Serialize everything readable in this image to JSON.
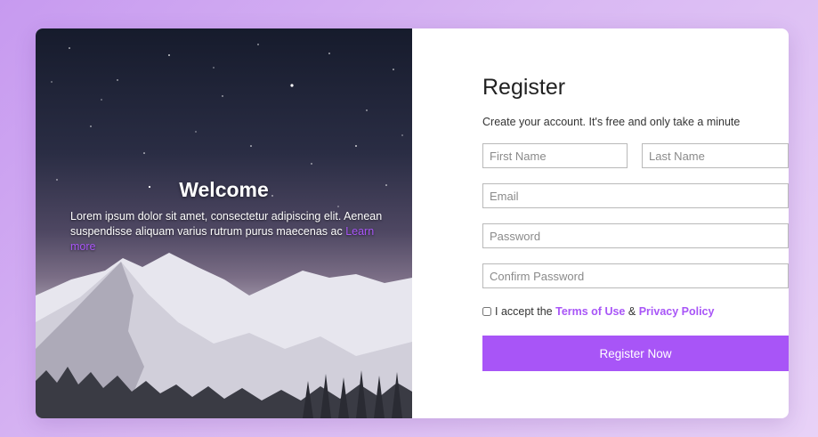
{
  "hero": {
    "title": "Welcome",
    "body": "Lorem ipsum dolor sit amet, consectetur adipiscing elit. Aenean suspendisse aliquam varius rutrum purus maecenas ac ",
    "link": "Learn more"
  },
  "form": {
    "title": "Register",
    "subtitle": "Create your account. It's free and only take a minute",
    "first_name_placeholder": "First Name",
    "last_name_placeholder": "Last Name",
    "email_placeholder": "Email",
    "password_placeholder": "Password",
    "confirm_password_placeholder": "Confirm Password",
    "terms_prefix": "I accept the ",
    "terms_link": "Terms of Use",
    "terms_amp": " & ",
    "privacy_link": "Privacy Policy",
    "submit_label": "Register Now"
  },
  "colors": {
    "accent": "#a855f7",
    "background_gradient_start": "#c79af0",
    "background_gradient_end": "#e8d2f7"
  }
}
